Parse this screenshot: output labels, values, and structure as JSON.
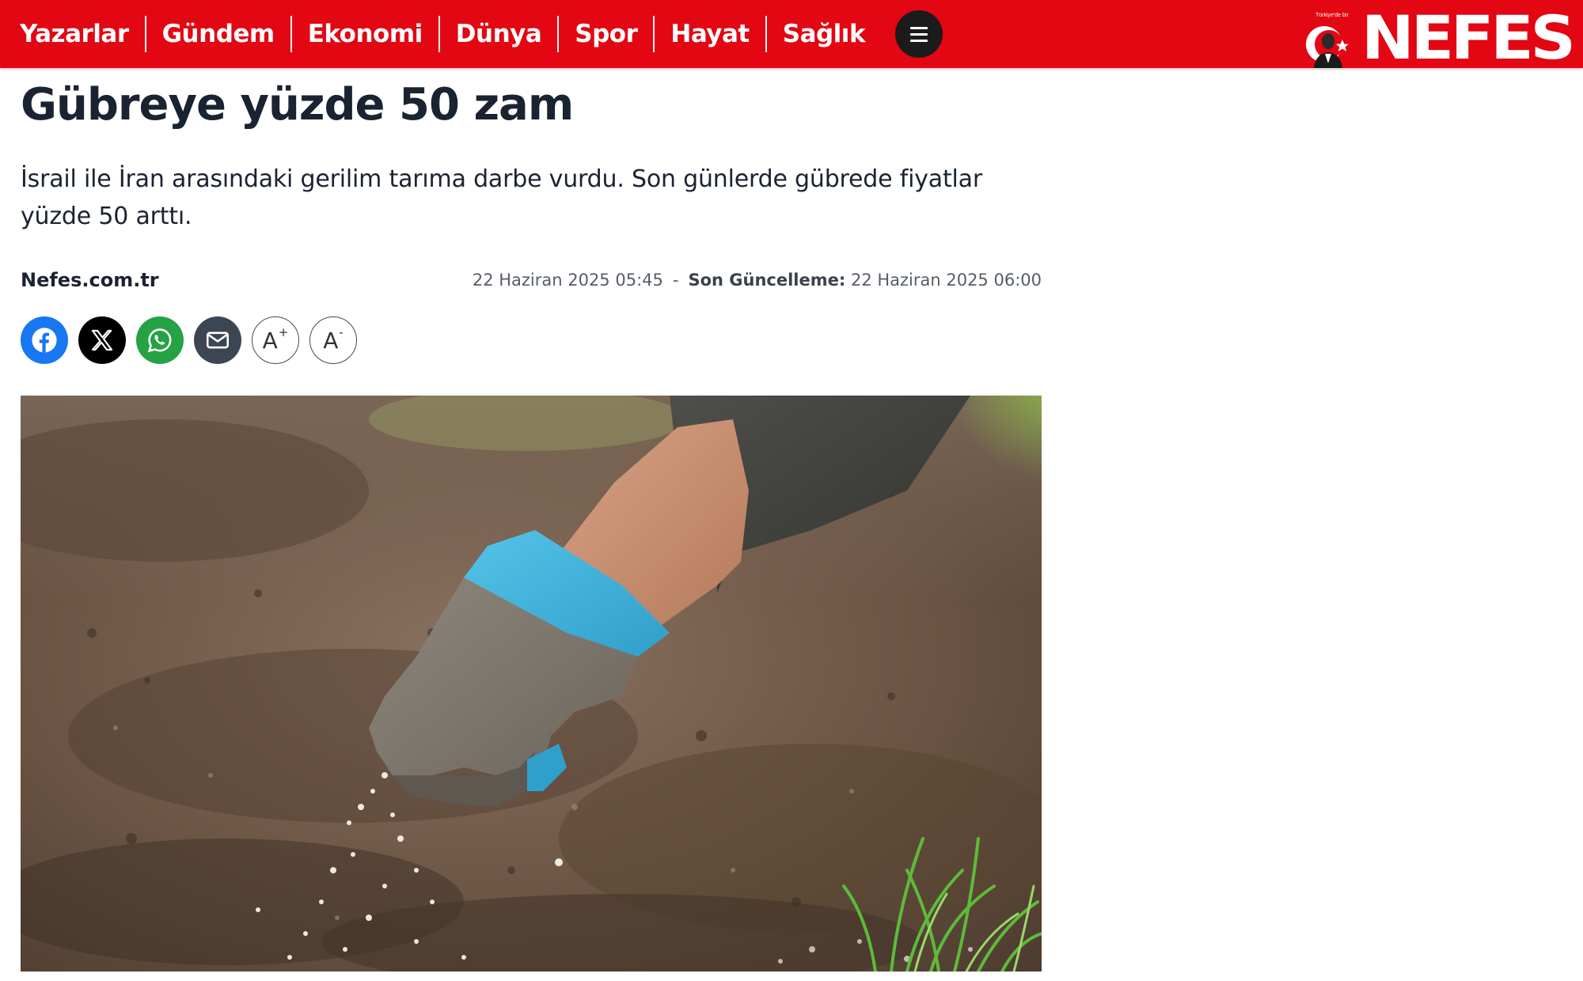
{
  "nav": {
    "items": [
      {
        "label": "Yazarlar"
      },
      {
        "label": "Gündem"
      },
      {
        "label": "Ekonomi"
      },
      {
        "label": "Dünya"
      },
      {
        "label": "Spor"
      },
      {
        "label": "Hayat"
      },
      {
        "label": "Sağlık"
      }
    ],
    "menu_icon": "hamburger-menu-icon"
  },
  "brand": {
    "name": "NEFES",
    "tagline": "Türkiye'de bir",
    "color": "#e30613"
  },
  "article": {
    "title": "Gübreye yüzde 50 zam",
    "summary": "İsrail ile İran arasındaki gerilim tarıma darbe vurdu. Son günlerde gübrede fiyatlar yüzde 50 arttı.",
    "source": "Nefes.com.tr",
    "published": "22 Haziran 2025 05:45",
    "separator": "-",
    "updated_label": "Son Güncelleme:",
    "updated": "22 Haziran 2025 06:00"
  },
  "share": {
    "buttons": [
      {
        "icon": "facebook-icon",
        "color": "#1877f2"
      },
      {
        "icon": "x-icon",
        "color": "#000000"
      },
      {
        "icon": "whatsapp-icon",
        "color": "#25a244"
      },
      {
        "icon": "mail-icon",
        "color": "#3c4652"
      }
    ],
    "font_increase": {
      "letter": "A",
      "sign": "+"
    },
    "font_decrease": {
      "letter": "A",
      "sign": "-"
    }
  },
  "image": {
    "subject": "gloved-hand-spreading-fertilizer-on-soil"
  }
}
